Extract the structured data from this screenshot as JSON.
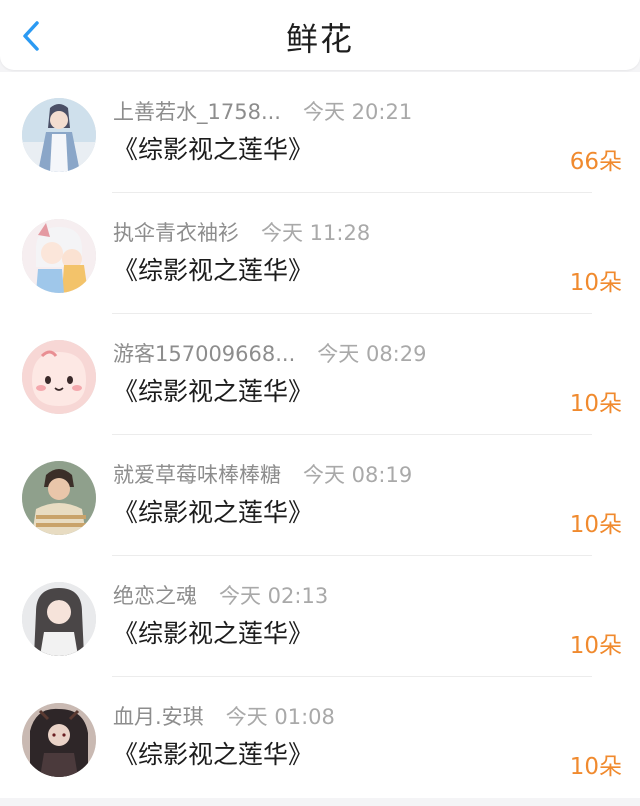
{
  "header": {
    "back_icon": "chevron-left-icon",
    "title": "鲜花",
    "accent_color": "#2b9af3"
  },
  "colors": {
    "count": "#f08a2e",
    "name": "#8d8d8d",
    "time": "#a9a9a9"
  },
  "records": [
    {
      "name": "上善若水_1758...",
      "time": "今天 20:21",
      "book": "《综影视之莲华》",
      "count": "66朵"
    },
    {
      "name": "执伞青衣袖衫",
      "time": "今天 11:28",
      "book": "《综影视之莲华》",
      "count": "10朵"
    },
    {
      "name": "游客157009668...",
      "time": "今天 08:29",
      "book": "《综影视之莲华》",
      "count": "10朵"
    },
    {
      "name": "就爱草莓味棒棒糖",
      "time": "今天 08:19",
      "book": "《综影视之莲华》",
      "count": "10朵"
    },
    {
      "name": "绝恋之魂",
      "time": "今天 02:13",
      "book": "《综影视之莲华》",
      "count": "10朵"
    },
    {
      "name": "血月.安琪",
      "time": "今天 01:08",
      "book": "《综影视之莲华》",
      "count": "10朵"
    }
  ]
}
